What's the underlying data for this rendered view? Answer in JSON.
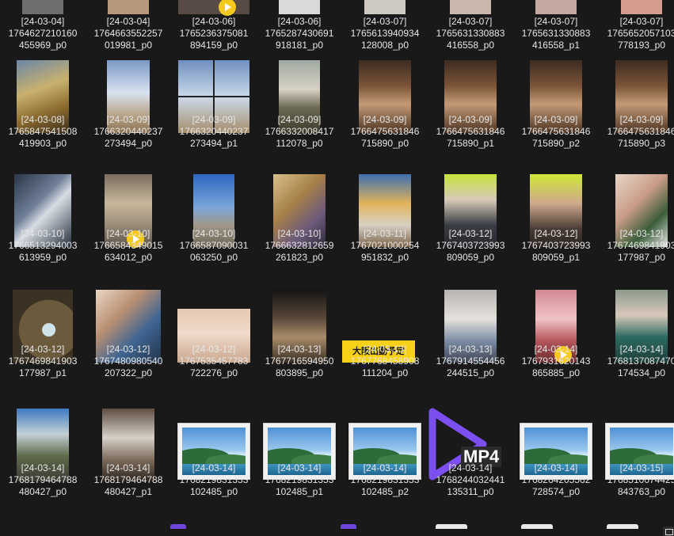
{
  "explorer": {
    "overlay_text": {
      "mp4_badge": "MP4",
      "banner_text": "大阪出勤予定"
    },
    "rows": [
      [
        {
          "date": "[24-03-04]",
          "id1": "1764627210160",
          "id2": "455969_p0"
        },
        {
          "date": "[24-03-04]",
          "id1": "1764663552257",
          "id2": "019981_p0"
        },
        {
          "date": "[24-03-06]",
          "id1": "1765236375081",
          "id2": "894159_p0",
          "video": true
        },
        {
          "date": "[24-03-06]",
          "id1": "1765287430691",
          "id2": "918181_p0"
        },
        {
          "date": "[24-03-07]",
          "id1": "1765613940934",
          "id2": "128008_p0"
        },
        {
          "date": "[24-03-07]",
          "id1": "1765631330883",
          "id2": "416558_p0"
        },
        {
          "date": "[24-03-07]",
          "id1": "1765631330883",
          "id2": "416558_p1"
        },
        {
          "date": "[24-03-07]",
          "id1": "1765652057103",
          "id2": "778193_p0"
        }
      ],
      [
        {
          "date": "[24-03-08]",
          "id1": "1765847541508",
          "id2": "419903_p0",
          "thumb": "golden-room"
        },
        {
          "date": "[24-03-09]",
          "id1": "1766320440237",
          "id2": "273494_p0",
          "thumb": "sky-figure"
        },
        {
          "date": "[24-03-09]",
          "id1": "1766320440237",
          "id2": "273494_p1",
          "thumb": "sky-grid"
        },
        {
          "date": "[24-03-09]",
          "id1": "1766332008417",
          "id2": "112078_p0",
          "thumb": "onsen"
        },
        {
          "date": "[24-03-09]",
          "id1": "1766475631846",
          "id2": "715890_p0",
          "thumb": "dinner"
        },
        {
          "date": "[24-03-09]",
          "id1": "1766475631846",
          "id2": "715890_p1",
          "thumb": "dinner"
        },
        {
          "date": "[24-03-09]",
          "id1": "1766475631846",
          "id2": "715890_p2",
          "thumb": "dinner"
        },
        {
          "date": "[24-03-09]",
          "id1": "1766475631846",
          "id2": "715890_p3",
          "thumb": "dinner"
        }
      ],
      [
        {
          "date": "[24-03-10]",
          "id1": "1766513294003",
          "id2": "613959_p0",
          "thumb": "photos"
        },
        {
          "date": "[24-03-10]",
          "id1": "1766584349015",
          "id2": "634012_p0",
          "thumb": "room",
          "video": true
        },
        {
          "date": "[24-03-10]",
          "id1": "1766587090031",
          "id2": "063250_p0",
          "thumb": "statue"
        },
        {
          "date": "[24-03-10]",
          "id1": "1766632812659",
          "id2": "261823_p0",
          "thumb": "figure"
        },
        {
          "date": "[24-03-11]",
          "id1": "1767021000254",
          "id2": "951832_p0",
          "thumb": "park"
        },
        {
          "date": "[24-03-12]",
          "id1": "1767403723993",
          "id2": "809059_p0",
          "thumb": "beanie"
        },
        {
          "date": "[24-03-12]",
          "id1": "1767403723993",
          "id2": "809059_p1",
          "thumb": "beanie2"
        },
        {
          "date": "[24-03-12]",
          "id1": "1767469841903",
          "id2": "177987_p0",
          "thumb": "bird-shoulder"
        }
      ],
      [
        {
          "date": "[24-03-12]",
          "id1": "1767469841903",
          "id2": "177987_p1",
          "thumb": "nest"
        },
        {
          "date": "[24-03-12]",
          "id1": "1767480980540",
          "id2": "207322_p0",
          "thumb": "jeans"
        },
        {
          "date": "[24-03-12]",
          "id1": "1767535457783",
          "id2": "722276_p0",
          "thumb": "bath"
        },
        {
          "date": "[24-03-13]",
          "id1": "1767716594950",
          "id2": "803895_p0",
          "thumb": "dark-bath"
        },
        {
          "date": "[24-03-13]",
          "id1": "1767768458908",
          "id2": "111204_p0",
          "thumb": "banner"
        },
        {
          "date": "[24-03-13]",
          "id1": "1767914554456",
          "id2": "244515_p0",
          "thumb": "mirror"
        },
        {
          "date": "[24-03-14]",
          "id1": "1767931620143",
          "id2": "865885_p0",
          "thumb": "pink",
          "video": true
        },
        {
          "date": "[24-03-14]",
          "id1": "1768137087470",
          "id2": "174534_p0",
          "thumb": "green"
        }
      ],
      [
        {
          "date": "[24-03-14]",
          "id1": "1768179464788",
          "id2": "480427_p0",
          "thumb": "shrine"
        },
        {
          "date": "[24-03-14]",
          "id1": "1768179464788",
          "id2": "480427_p1",
          "thumb": "cafe"
        },
        {
          "date": "[24-03-14]",
          "id1": "1768219831353",
          "id2": "102485_p0",
          "thumb": "placeholder"
        },
        {
          "date": "[24-03-14]",
          "id1": "1768219831353",
          "id2": "102485_p1",
          "thumb": "placeholder"
        },
        {
          "date": "[24-03-14]",
          "id1": "1768219831353",
          "id2": "102485_p2",
          "thumb": "placeholder"
        },
        {
          "date": "[24-03-14]",
          "id1": "1768244032441",
          "id2": "135311_p0",
          "thumb": "mp4"
        },
        {
          "date": "[24-03-14]",
          "id1": "1768264205562",
          "id2": "728574_p0",
          "thumb": "placeholder"
        },
        {
          "date": "[24-03-15]",
          "id1": "1768510074425",
          "id2": "843763_p0",
          "thumb": "placeholder"
        }
      ]
    ]
  }
}
